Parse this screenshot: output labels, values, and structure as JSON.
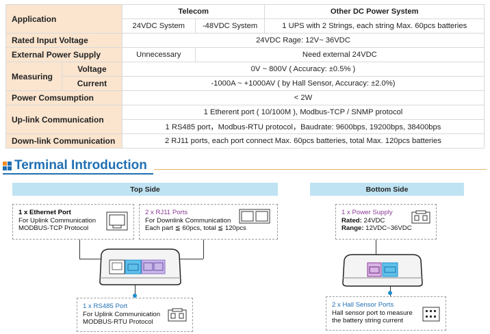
{
  "spec_table": {
    "application_label": "Application",
    "telecom_header": "Telecom",
    "other_dc_header": "Other DC Power System",
    "telecom_24v": "24VDC System",
    "telecom_48v": "-48VDC System",
    "other_dc_value": "1 UPS with 2 Strings, each string Max. 60pcs batteries",
    "rated_input_label": "Rated Input Voltage",
    "rated_input_value": "24VDC Rage: 12V~ 36VDC",
    "ext_power_label": "External Power Supply",
    "ext_power_telecom": "Unnecessary",
    "ext_power_other": "Need external 24VDC",
    "measuring_label": "Measuring",
    "voltage_label": "Voltage",
    "voltage_value": "0V ~ 800V ( Accuracy: ±0.5% )",
    "current_label": "Current",
    "current_value": "-1000A ~ +1000AV ( by Hall Sensor, Accuracy: ±2.0%)",
    "power_label": "Power Comsumption",
    "power_value": "< 2W",
    "uplink_label": "Up-link Communication",
    "uplink_value1": "1 Etherent port ( 10/100M ), Modbus-TCP / SNMP protocol",
    "uplink_value2": "1 RS485 port，Modbus-RTU protocol，Baudrate: 9600bps, 19200bps, 38400bps",
    "downlink_label": "Down-link Communication",
    "downlink_value": "2 RJ11 ports, each port connect Max. 60pcs batteries, total Max. 120pcs batteries"
  },
  "section": {
    "title": "Terminal Introduction"
  },
  "top_side": {
    "title": "Top Side",
    "ethernet": {
      "title": "1 x Ethernet Port",
      "line1": "For Uplink Communication",
      "line2": "MODBUS-TCP Protocol"
    },
    "rj11": {
      "title": "2 x RJ11 Ports",
      "line1": "For Downlink Communication",
      "line2": "Each part ≦ 60pcs, total ≦ 120pcs"
    },
    "rs485": {
      "title": "1 x RS485 Port",
      "line1": "For Uplink Communication",
      "line2": "MODBUS-RTU Protocol"
    }
  },
  "bottom_side": {
    "title": "Bottom Side",
    "power": {
      "title": "1 x Power Supply",
      "rated_label": "Rated:",
      "rated_value": " 24VDC",
      "range_label": "Range:",
      "range_value": " 12VDC~36VDC"
    },
    "hall": {
      "title": "2 x Hall Sensor Ports",
      "line1": "Hall sensor port to measure",
      "line2": "the battery string current"
    }
  },
  "colors": {
    "label_bg": "#fbe5cf",
    "section_blue": "#1f6fb3",
    "bar_bg": "#bfe3f2",
    "accent_orange": "#f08a24"
  }
}
